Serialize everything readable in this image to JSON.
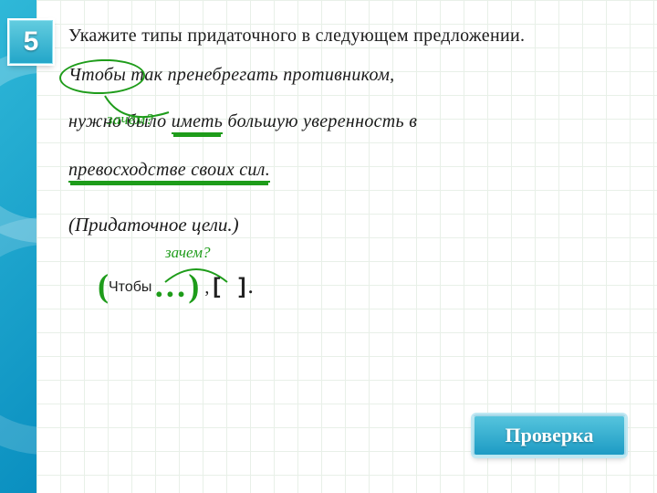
{
  "badge": "5",
  "task": "Укажите типы придаточного в следующем предложении.",
  "sentence": {
    "w_chtoby": "Чтобы",
    "rest1": "так пренебрегать противником,",
    "w_nuzhno": "нужно",
    "w_bylo": "было",
    "w_imet": "иметь",
    "rest2": "большую уверенность в",
    "line3": "превосходстве своих сил."
  },
  "annot": "зачем?",
  "answer": "(Придаточное цели.)",
  "scheme": {
    "annot": "зачем?",
    "conj": "Чтобы",
    "dots": "…",
    "comma": ",",
    "open_bracket": "[",
    "close_bracket": "]",
    "period": "."
  },
  "check_btn": "Проверка"
}
